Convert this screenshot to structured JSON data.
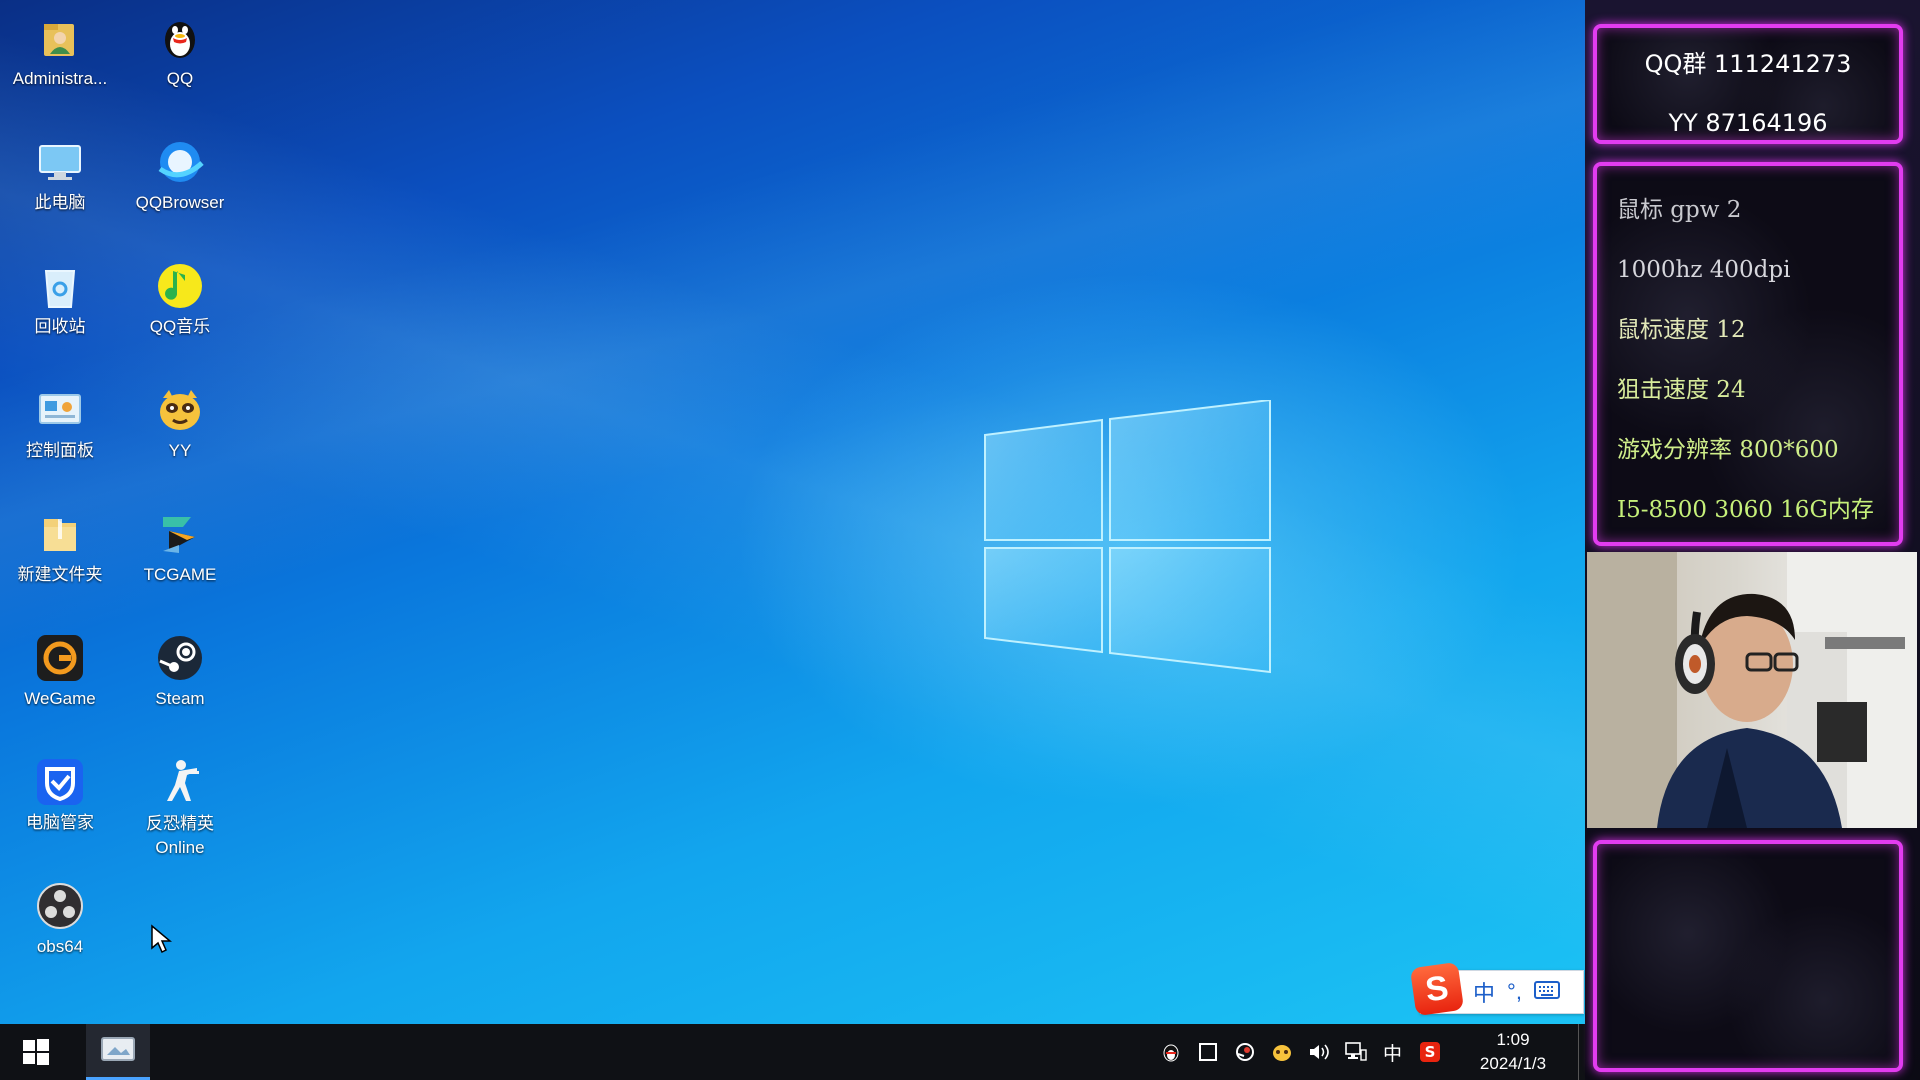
{
  "desktop": {
    "icons": [
      {
        "label": "Administra...",
        "icon": "user-folder-icon"
      },
      {
        "label": "QQ",
        "icon": "qq-penguin-icon"
      },
      {
        "label": "此电脑",
        "icon": "this-pc-icon"
      },
      {
        "label": "QQBrowser",
        "icon": "qqbrowser-icon"
      },
      {
        "label": "回收站",
        "icon": "recycle-bin-icon"
      },
      {
        "label": "QQ音乐",
        "icon": "qq-music-icon"
      },
      {
        "label": "控制面板",
        "icon": "control-panel-icon"
      },
      {
        "label": "YY",
        "icon": "yy-icon"
      },
      {
        "label": "新建文件夹",
        "icon": "folder-icon"
      },
      {
        "label": "TCGAME",
        "icon": "tcgame-icon"
      },
      {
        "label": "WeGame",
        "icon": "wegame-icon"
      },
      {
        "label": "Steam",
        "icon": "steam-icon"
      },
      {
        "label": "电脑管家",
        "icon": "pc-manager-icon"
      },
      {
        "label": "反恐精英\nOnline",
        "icon": "counter-strike-icon"
      },
      {
        "label": "obs64",
        "icon": "obs-icon"
      }
    ]
  },
  "ime": {
    "mode": "中",
    "punct": "°,",
    "keyboard_icon": "keyboard-icon"
  },
  "taskbar": {
    "tray_icons": [
      "qq-tray-icon",
      "window-tray-icon",
      "steam-tray-icon",
      "yy-tray-icon",
      "volume-icon",
      "network-icon",
      "ime-mode-icon",
      "sogou-icon"
    ],
    "ime_mode_label": "中",
    "time": "1:09",
    "date": "2024/1/3"
  },
  "overlay": {
    "contact": {
      "qq_group": "QQ群 111241273",
      "yy": "YY  87164196"
    },
    "specs": [
      "鼠标 gpw 2",
      "1000hz 400dpi",
      "鼠标速度 12",
      "狙击速度 24",
      "游戏分辨率 800*600",
      "I5-8500 3060 16G内存"
    ],
    "accent_colors": {
      "neon": "#e23cf0",
      "gold": "#f7b955"
    }
  }
}
